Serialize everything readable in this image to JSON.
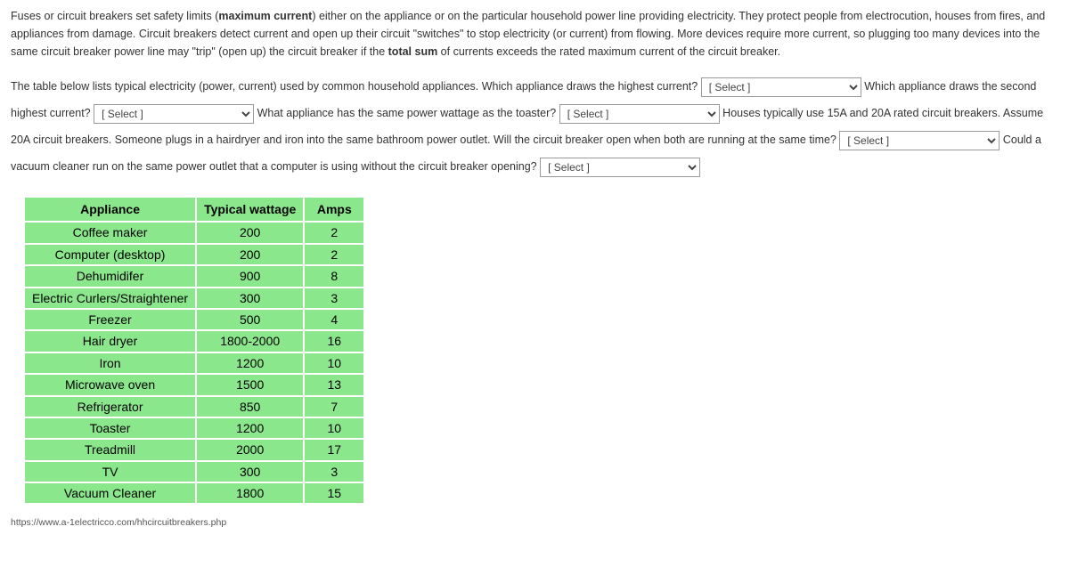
{
  "intro": {
    "p1_a": "Fuses or circuit breakers set safety limits (",
    "p1_b": "maximum current",
    "p1_c": ") either on the appliance or on the particular household power line providing electricity. They protect people from electrocution, houses from fires, and appliances from damage. Circuit breakers detect current and open up their circuit \"switches\" to stop electricity (or current) from flowing. More devices require more current, so plugging too many devices into the same circuit breaker power line may \"trip\" (open up) the circuit breaker if the ",
    "p1_d": "total sum",
    "p1_e": " of currents exceeds the rated maximum current of the circuit breaker."
  },
  "questions": {
    "q1": "The table below lists typical electricity (power, current) used by common household appliances. Which appliance draws the highest current? ",
    "q2a": " Which appliance draws the second highest current? ",
    "q3a": " What appliance has the same power wattage as the toaster? ",
    "q4a": " Houses typically use 15A and 20A rated circuit breakers. Assume 20A circuit breakers. Someone plugs in a hairdryer and iron into the same bathroom power outlet. Will the circuit breaker open when both are running at the same time? ",
    "q5a": " Could a vacuum cleaner run on the same power outlet that a computer is using without the circuit breaker opening? ",
    "select_placeholder": "[ Select ]"
  },
  "table": {
    "headers": {
      "c1": "Appliance",
      "c2": "Typical wattage",
      "c3": "Amps"
    },
    "rows": [
      {
        "name": "Coffee maker",
        "watt": "200",
        "amps": "2"
      },
      {
        "name": "Computer (desktop)",
        "watt": "200",
        "amps": "2"
      },
      {
        "name": "Dehumidifer",
        "watt": "900",
        "amps": "8"
      },
      {
        "name": "Electric Curlers/Straightener",
        "watt": "300",
        "amps": "3"
      },
      {
        "name": "Freezer",
        "watt": "500",
        "amps": "4"
      },
      {
        "name": "Hair dryer",
        "watt": "1800-2000",
        "amps": "16"
      },
      {
        "name": "Iron",
        "watt": "1200",
        "amps": "10"
      },
      {
        "name": "Microwave oven",
        "watt": "1500",
        "amps": "13"
      },
      {
        "name": "Refrigerator",
        "watt": "850",
        "amps": "7"
      },
      {
        "name": "Toaster",
        "watt": "1200",
        "amps": "10"
      },
      {
        "name": "Treadmill",
        "watt": "2000",
        "amps": "17"
      },
      {
        "name": "TV",
        "watt": "300",
        "amps": "3"
      },
      {
        "name": "Vacuum Cleaner",
        "watt": "1800",
        "amps": "15"
      }
    ]
  },
  "source": "https://www.a-1electricco.com/hhcircuitbreakers.php"
}
